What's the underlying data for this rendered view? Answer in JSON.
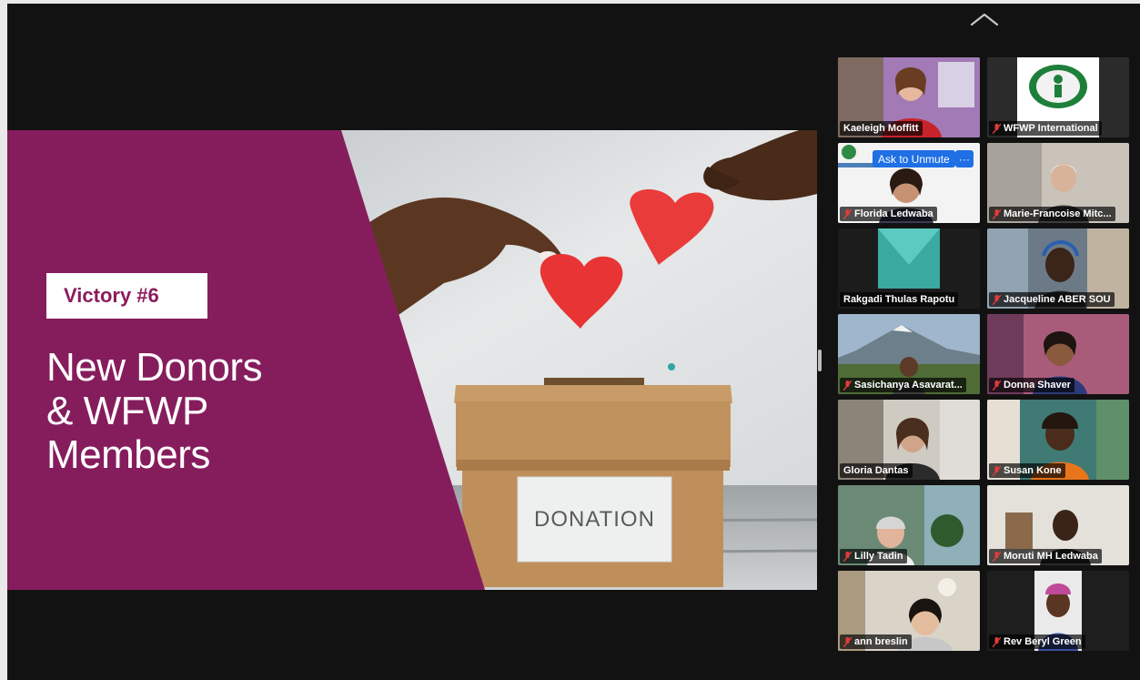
{
  "slide": {
    "badge": "Victory #6",
    "title_lines": [
      "New Donors",
      "& WFWP",
      "Members"
    ],
    "box_label": "DONATION",
    "panel_color": "#851d5d"
  },
  "participants": [
    {
      "name": "Kaeleigh Moffitt",
      "muted": false,
      "active": true
    },
    {
      "name": "WFWP International",
      "muted": true
    },
    {
      "name": "Florida Ledwaba",
      "muted": true
    },
    {
      "name": "Marie-Francoise Mitc...",
      "muted": true
    },
    {
      "name": "Rakgadi Thulas Rapotu",
      "muted": false
    },
    {
      "name": "Jacqueline ABER SOU",
      "muted": true
    },
    {
      "name": "Sasichanya Asavarat...",
      "muted": true
    },
    {
      "name": "Donna Shaver",
      "muted": true
    },
    {
      "name": "Gloria Dantas",
      "muted": false
    },
    {
      "name": "Susan Kone",
      "muted": true
    },
    {
      "name": "Lilly Tadin",
      "muted": true
    },
    {
      "name": "Moruti MH Ledwaba",
      "muted": true
    },
    {
      "name": "ann breslin",
      "muted": true
    },
    {
      "name": "Rev Beryl Green",
      "muted": true
    }
  ],
  "tile_actions": {
    "ask_to_unmute": "Ask to Unmute",
    "more": "···"
  },
  "icons": {
    "collapse": "chevron-up-icon",
    "mic_muted": "mic-muted-icon"
  },
  "colors": {
    "active_speaker": "#4fd44b",
    "muted_icon": "#e23b3b",
    "unmute_button": "#1f6fe5"
  }
}
